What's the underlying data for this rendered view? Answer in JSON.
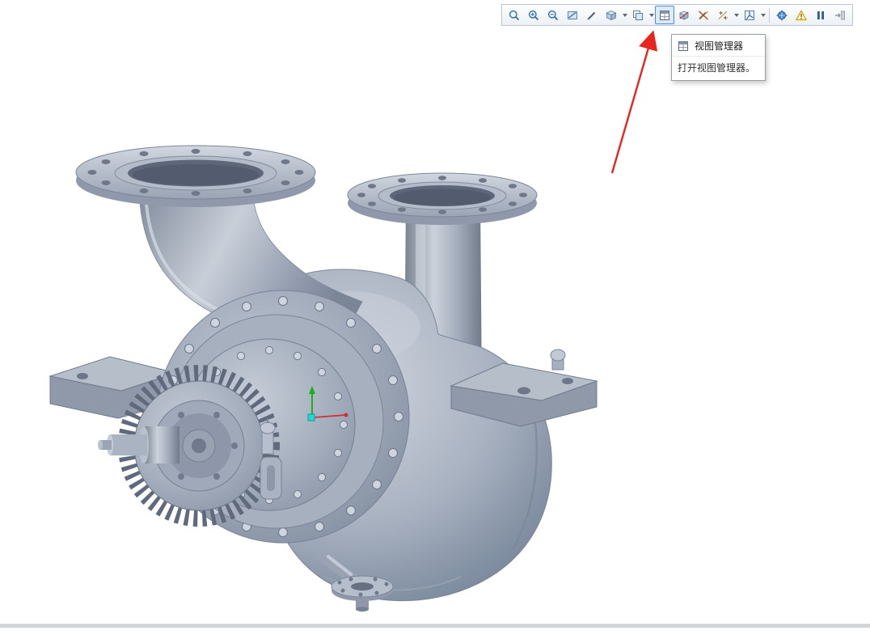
{
  "window": {
    "background_color": "#ffffff",
    "bottom_edge_color": "#d2d6db"
  },
  "toolbar": {
    "active_button": "view-manager",
    "buttons": [
      {
        "icon": "refit-icon"
      },
      {
        "icon": "zoom-in-icon"
      },
      {
        "icon": "zoom-out-icon"
      },
      {
        "icon": "repaint-icon"
      },
      {
        "icon": "edit-style-icon"
      },
      {
        "icon": "display-style-icon",
        "has_dropdown": true
      },
      {
        "icon": "saved-orientations-icon",
        "has_dropdown": true
      },
      {
        "icon": "view-manager-icon",
        "active": true
      },
      {
        "icon": "section-view-icon"
      },
      {
        "icon": "annotation-display-icon"
      },
      {
        "icon": "datum-display-icon",
        "has_dropdown": true
      },
      {
        "icon": "spin-center-icon",
        "has_dropdown": true
      },
      {
        "icon": "dragger-icon"
      },
      {
        "icon": "warning-icon"
      },
      {
        "icon": "pause-icon"
      },
      {
        "icon": "exit-view-icon"
      }
    ]
  },
  "tooltip": {
    "title": "视图管理器",
    "description": "打开视图管理器。"
  },
  "annotation_arrow": {
    "color": "#e8251f"
  },
  "viewport": {
    "content": "3d-pump-assembly-model",
    "model_body_color": "#aab4c3"
  }
}
